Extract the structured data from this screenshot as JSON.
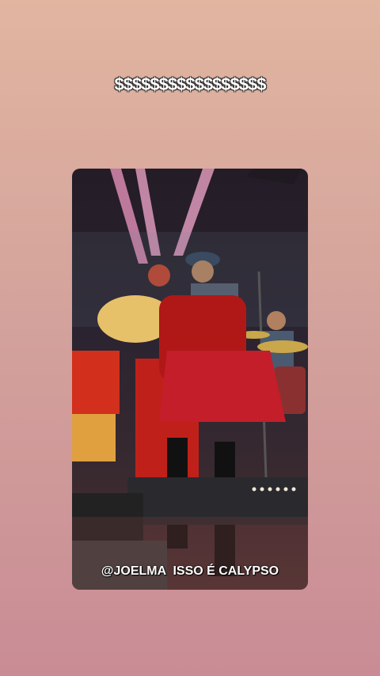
{
  "story": {
    "caption": "$$$$$$$$$$$$$$$$$",
    "overlay_text": "@JOELMA  ISSO É CALYPSO"
  },
  "colors": {
    "background_top": "#e1b5a0",
    "background_bottom": "#c98c95",
    "caption_color": "#ffffff"
  }
}
